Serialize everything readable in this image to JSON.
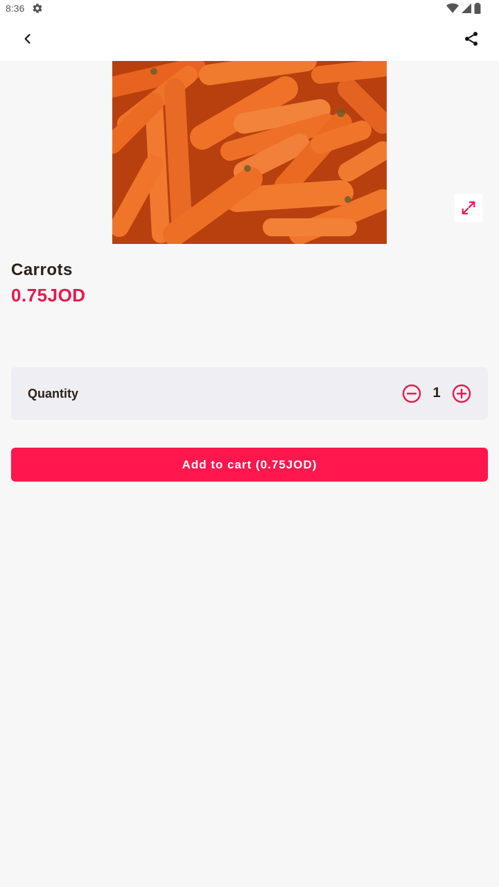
{
  "status_bar": {
    "time": "8:36",
    "gear_icon": "gear-icon",
    "wifi_icon": "wifi-icon",
    "signal_icon": "signal-icon",
    "battery_icon": "battery-icon"
  },
  "app_bar": {
    "back_icon": "chevron-left-icon",
    "share_icon": "share-icon"
  },
  "product": {
    "image_alt": "Carrots",
    "name": "Carrots",
    "price": "0.75JOD",
    "expand_icon": "expand-icon"
  },
  "quantity": {
    "label": "Quantity",
    "value": "1",
    "minus_icon": "minus-circle-icon",
    "plus_icon": "plus-circle-icon"
  },
  "cart": {
    "button_label": "Add to cart (0.75JOD)"
  },
  "colors": {
    "accent": "#ff174d",
    "price": "#e5194d",
    "background": "#f7f7f7",
    "card": "#efeef2",
    "text": "#2b2118"
  }
}
